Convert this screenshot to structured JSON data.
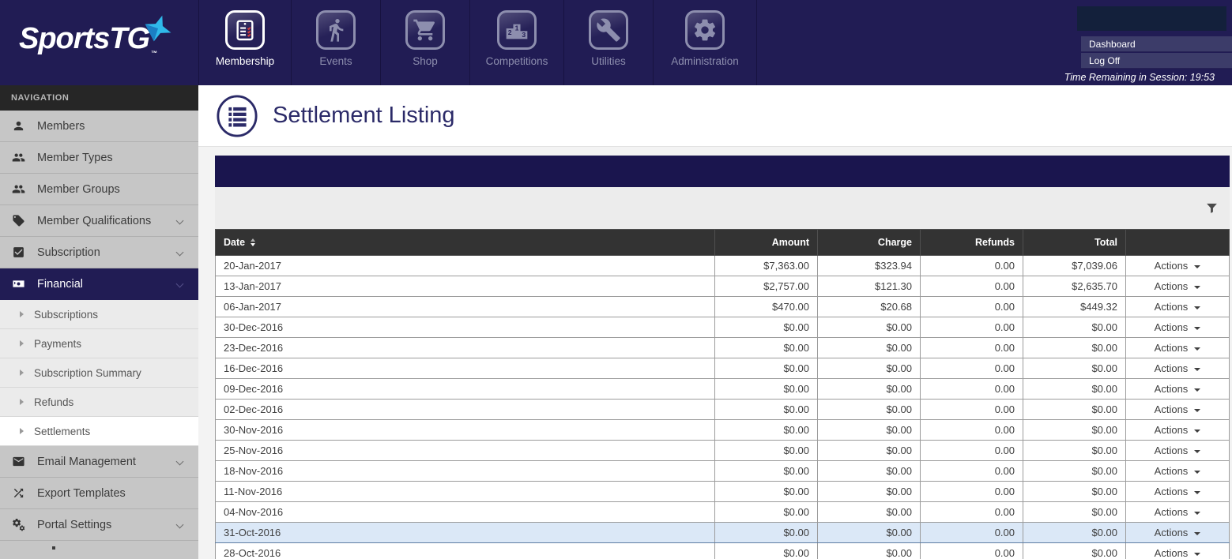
{
  "brand": {
    "name": "SportsTG",
    "trademark": "™",
    "star_icon": "four-point-star",
    "star_color": "#2fb9ea"
  },
  "colors": {
    "topbar_navy": "#211c54",
    "panel_navy": "#1a154e",
    "table_header": "#333333",
    "sidebar_gray": "#c6c6c6",
    "highlight_row": "#dbe8f7",
    "active_white": "#ffffff"
  },
  "top_nav": {
    "items": [
      {
        "label": "Membership",
        "icon": "membership-clipboard-icon",
        "active": true
      },
      {
        "label": "Events",
        "icon": "runner-icon",
        "active": false
      },
      {
        "label": "Shop",
        "icon": "cart-icon",
        "active": false
      },
      {
        "label": "Competitions",
        "icon": "podium-icon",
        "active": false
      },
      {
        "label": "Utilities",
        "icon": "wrench-icon",
        "active": false
      },
      {
        "label": "Administration",
        "icon": "gear-icon",
        "active": false
      }
    ]
  },
  "session": {
    "dashboard_label": "Dashboard",
    "log_off_label": "Log Off",
    "time_remaining": "Time Remaining in Session: 19:53"
  },
  "sidebar": {
    "header": "NAVIGATION",
    "items": [
      {
        "label": "Members",
        "icon": "person-icon"
      },
      {
        "label": "Member Types",
        "icon": "group-icon"
      },
      {
        "label": "Member Groups",
        "icon": "group-icon"
      },
      {
        "label": "Member Qualifications",
        "icon": "tag-icon",
        "expandable": true
      },
      {
        "label": "Subscription",
        "icon": "checkbox-icon",
        "expandable": true
      },
      {
        "label": "Financial",
        "icon": "money-icon",
        "expandable": true,
        "active": true
      }
    ],
    "financial_sub_items": [
      {
        "label": "Subscriptions"
      },
      {
        "label": "Payments"
      },
      {
        "label": "Subscription Summary"
      },
      {
        "label": "Refunds"
      },
      {
        "label": "Settlements",
        "active": true
      }
    ],
    "items_lower": [
      {
        "label": "Email Management",
        "icon": "envelope-icon",
        "expandable": true
      },
      {
        "label": "Export Templates",
        "icon": "shuffle-icon"
      },
      {
        "label": "Portal Settings",
        "icon": "gears-icon",
        "expandable": true
      }
    ]
  },
  "page": {
    "title": "Settlement Listing",
    "title_icon": "list-circle-icon",
    "filter_icon": "funnel-icon"
  },
  "table": {
    "columns": {
      "date": "Date",
      "amount": "Amount",
      "charge": "Charge",
      "refunds": "Refunds",
      "total": "Total",
      "actions": ""
    },
    "actions_label": "Actions",
    "sort_column": "Date",
    "rows": [
      {
        "date": "20-Jan-2017",
        "amount": "$7,363.00",
        "charge": "$323.94",
        "refunds": "0.00",
        "total": "$7,039.06"
      },
      {
        "date": "13-Jan-2017",
        "amount": "$2,757.00",
        "charge": "$121.30",
        "refunds": "0.00",
        "total": "$2,635.70"
      },
      {
        "date": "06-Jan-2017",
        "amount": "$470.00",
        "charge": "$20.68",
        "refunds": "0.00",
        "total": "$449.32"
      },
      {
        "date": "30-Dec-2016",
        "amount": "$0.00",
        "charge": "$0.00",
        "refunds": "0.00",
        "total": "$0.00"
      },
      {
        "date": "23-Dec-2016",
        "amount": "$0.00",
        "charge": "$0.00",
        "refunds": "0.00",
        "total": "$0.00"
      },
      {
        "date": "16-Dec-2016",
        "amount": "$0.00",
        "charge": "$0.00",
        "refunds": "0.00",
        "total": "$0.00"
      },
      {
        "date": "09-Dec-2016",
        "amount": "$0.00",
        "charge": "$0.00",
        "refunds": "0.00",
        "total": "$0.00"
      },
      {
        "date": "02-Dec-2016",
        "amount": "$0.00",
        "charge": "$0.00",
        "refunds": "0.00",
        "total": "$0.00"
      },
      {
        "date": "30-Nov-2016",
        "amount": "$0.00",
        "charge": "$0.00",
        "refunds": "0.00",
        "total": "$0.00"
      },
      {
        "date": "25-Nov-2016",
        "amount": "$0.00",
        "charge": "$0.00",
        "refunds": "0.00",
        "total": "$0.00"
      },
      {
        "date": "18-Nov-2016",
        "amount": "$0.00",
        "charge": "$0.00",
        "refunds": "0.00",
        "total": "$0.00"
      },
      {
        "date": "11-Nov-2016",
        "amount": "$0.00",
        "charge": "$0.00",
        "refunds": "0.00",
        "total": "$0.00"
      },
      {
        "date": "04-Nov-2016",
        "amount": "$0.00",
        "charge": "$0.00",
        "refunds": "0.00",
        "total": "$0.00"
      },
      {
        "date": "31-Oct-2016",
        "amount": "$0.00",
        "charge": "$0.00",
        "refunds": "0.00",
        "total": "$0.00",
        "highlighted": true
      },
      {
        "date": "28-Oct-2016",
        "amount": "$0.00",
        "charge": "$0.00",
        "refunds": "0.00",
        "total": "$0.00"
      }
    ]
  }
}
